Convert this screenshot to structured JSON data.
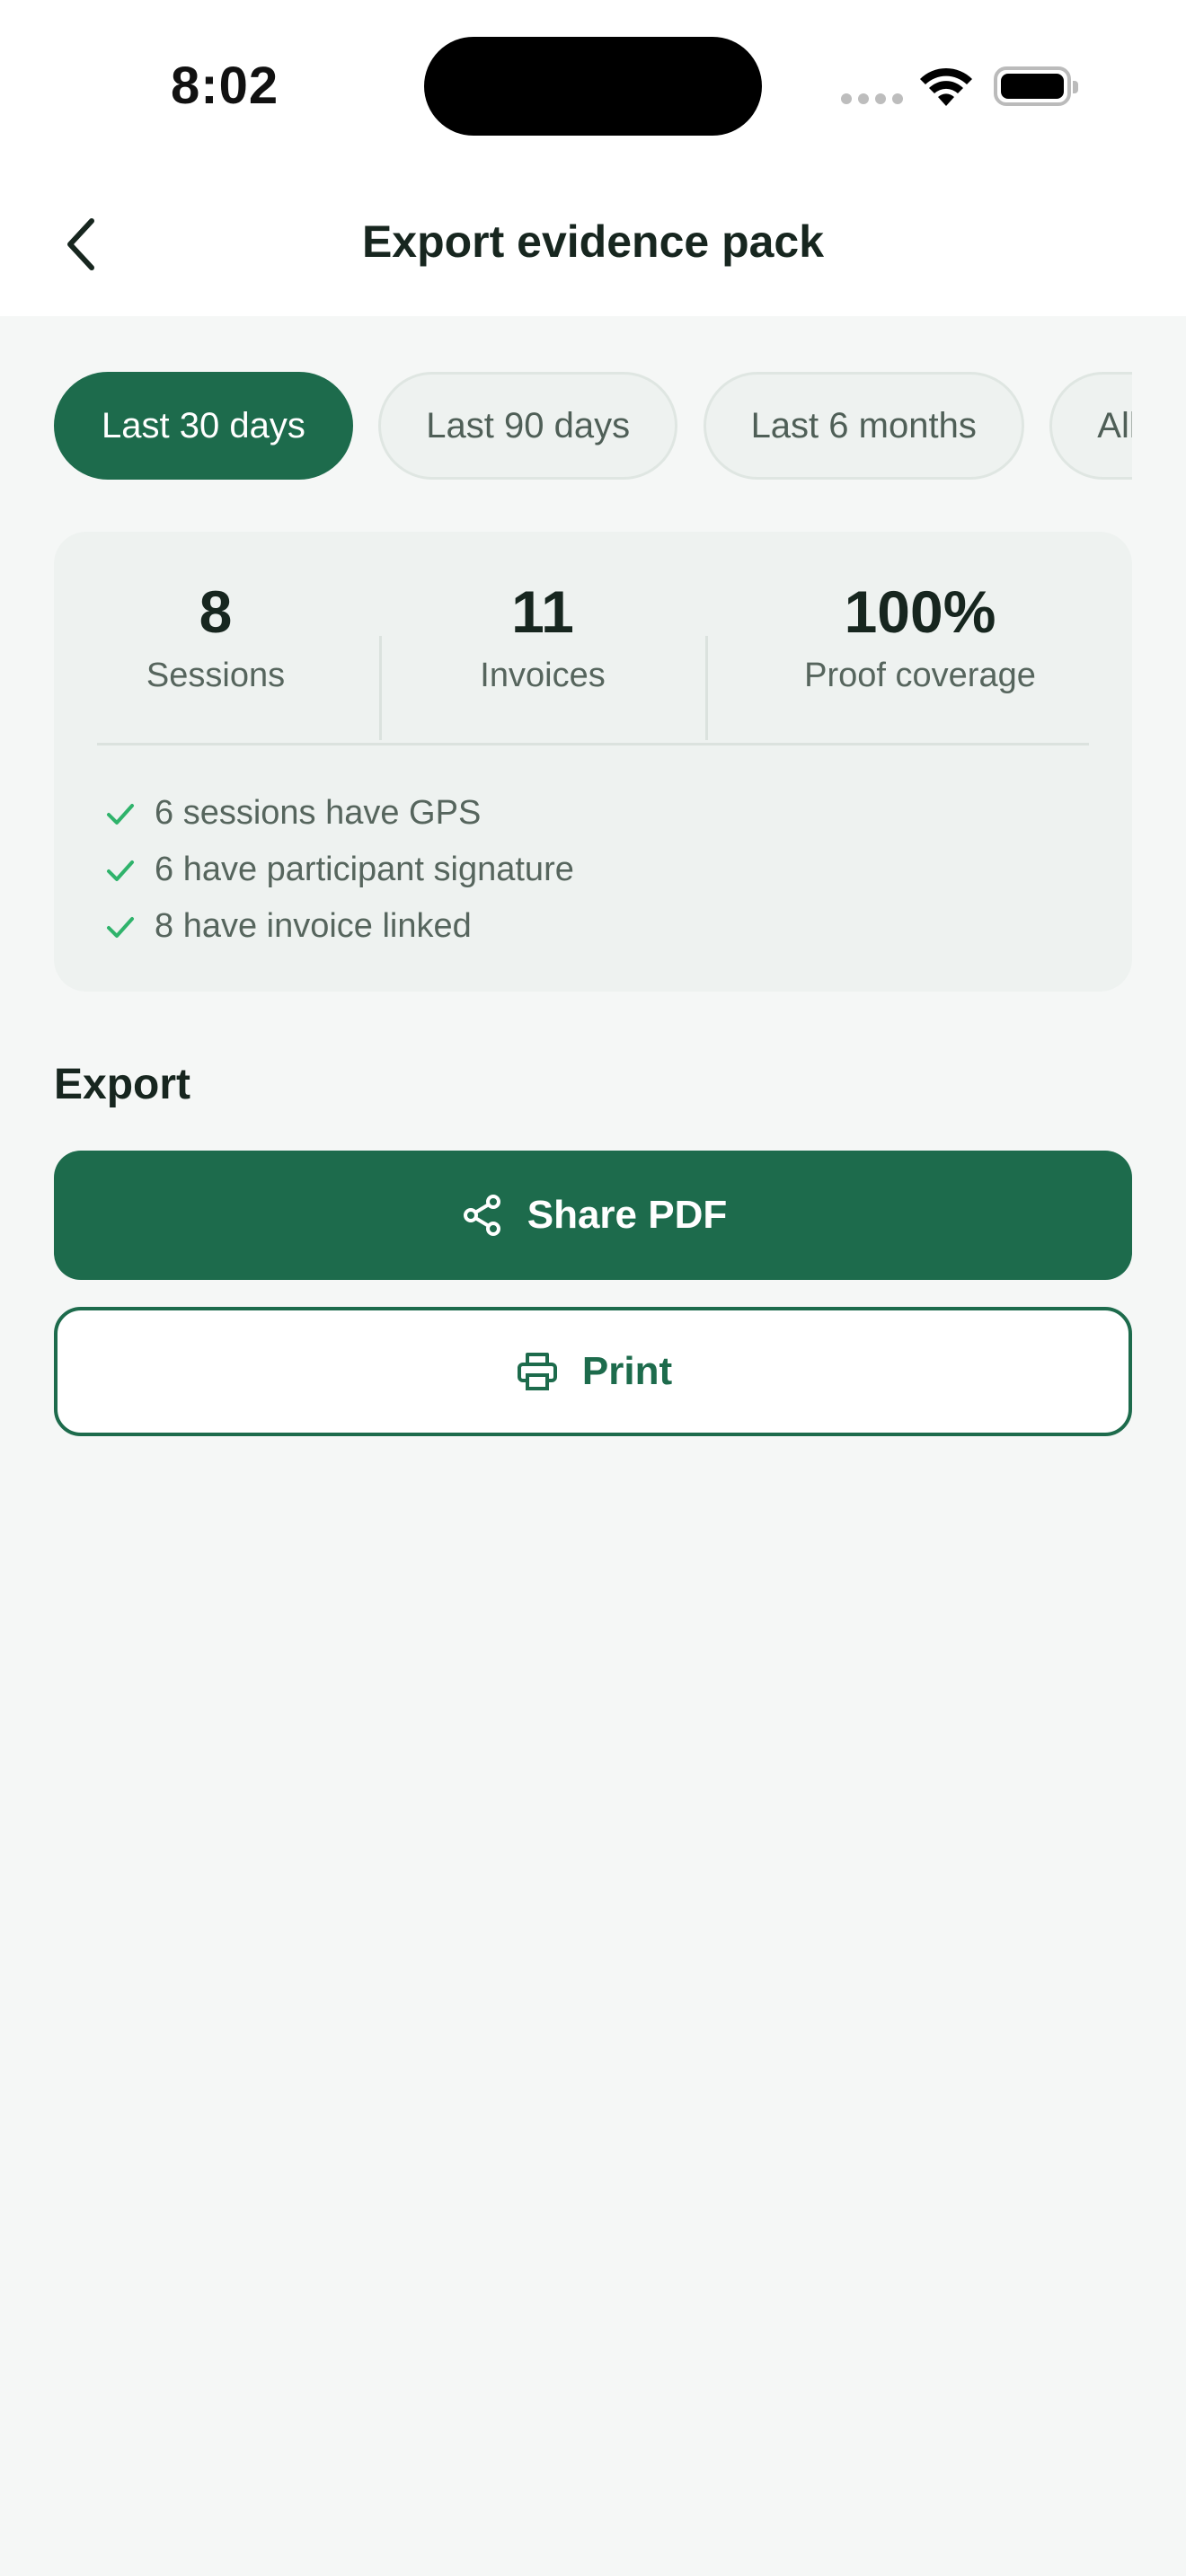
{
  "status_bar": {
    "time": "8:02"
  },
  "nav": {
    "title": "Export evidence pack",
    "back_icon": "chevron-left-icon"
  },
  "filters": {
    "chips": [
      "Last 30 days",
      "Last 90 days",
      "Last 6 months",
      "All time"
    ],
    "selected": "Last 30 days"
  },
  "summary": {
    "stats": [
      {
        "value": "8",
        "label": "Sessions"
      },
      {
        "value": "11",
        "label": "Invoices"
      },
      {
        "value": "100%",
        "label": "Proof coverage"
      }
    ],
    "checks": [
      "6 sessions have GPS",
      "6 have participant signature",
      "8 have invoice linked"
    ]
  },
  "export": {
    "title": "Export",
    "share_label": "Share PDF",
    "share_icon": "share-icon",
    "print_label": "Print",
    "print_icon": "printer-icon"
  },
  "colors": {
    "primary": "#1d6b4c",
    "check": "#2fb36b",
    "background": "#f5f7f6",
    "card": "#eef2f0"
  }
}
